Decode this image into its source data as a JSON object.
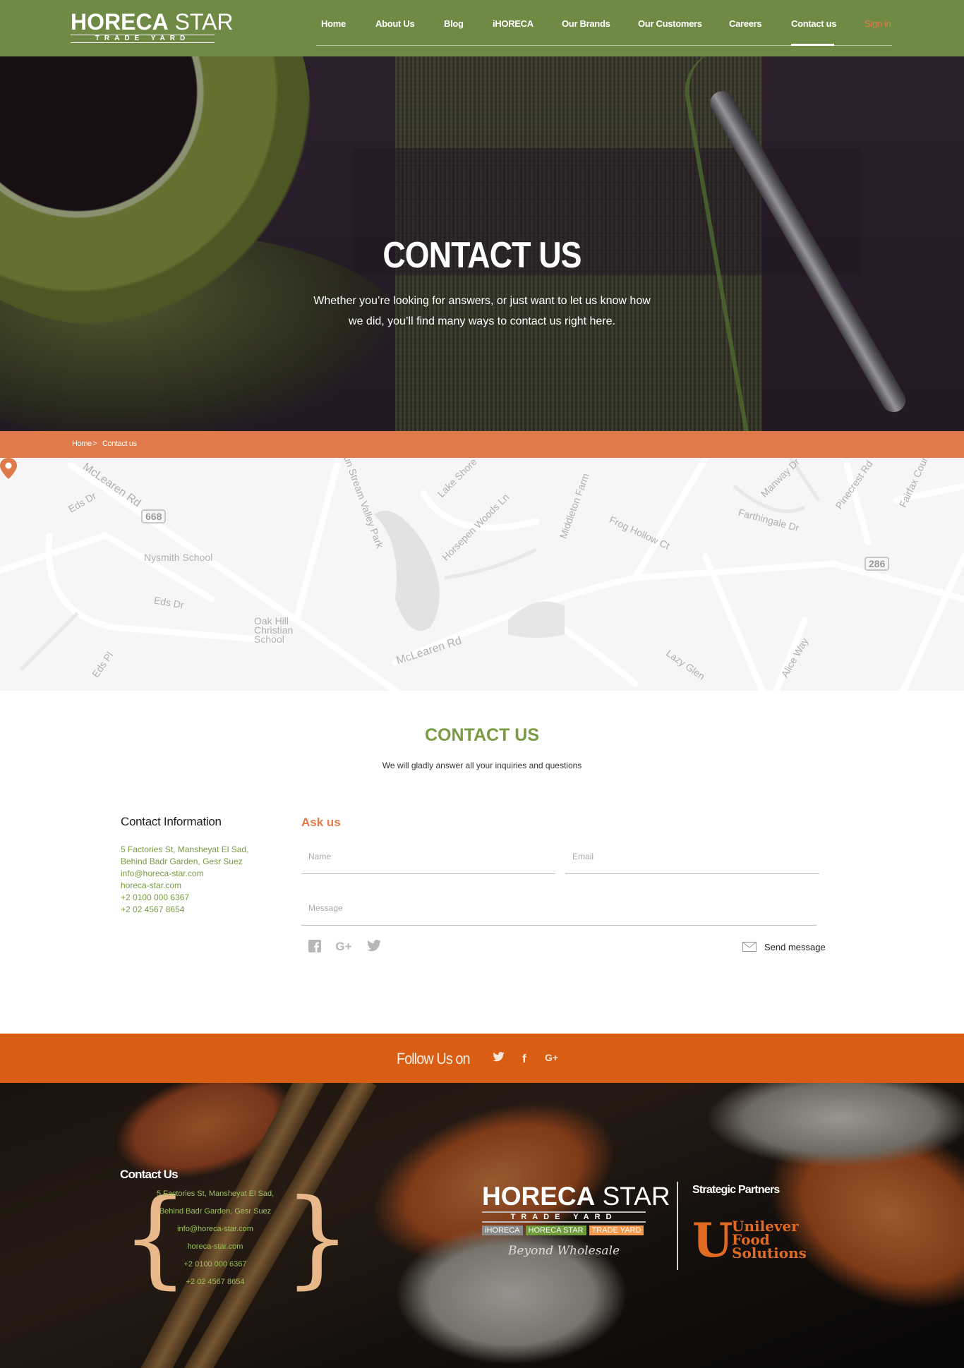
{
  "nav": {
    "logo": {
      "word1": "HORECA",
      "word2": "STAR",
      "sub": "TRADE YARD"
    },
    "items": [
      {
        "label": "Home"
      },
      {
        "label": "About Us"
      },
      {
        "label": "Blog"
      },
      {
        "label": "iHORECA"
      },
      {
        "label": "Our Brands"
      },
      {
        "label": "Our Customers"
      },
      {
        "label": "Careers"
      },
      {
        "label": "Contact us",
        "active": true
      }
    ],
    "signin": "Sign in"
  },
  "hero": {
    "title": "CONTACT US",
    "subtitle": "Whether you’re looking for answers, or just want to let us know how we did, you’ll find many ways to contact us right here."
  },
  "breadcrumb": {
    "home": "Home",
    "sep": ">",
    "current": "Contact us"
  },
  "map": {
    "labels": [
      "McLearen Rd",
      "Eds Dr",
      "668",
      "Nysmith School",
      "Eds Dr",
      "Oak Hill Christian School",
      "McLearen Rd",
      "Lake Shore",
      "Horsepen Woods Ln",
      "Middleton Farm",
      "Frog Hollow Ct",
      "Farthingale Dr",
      "Manway Dr",
      "Pinecrest Rd",
      "Fairfax Coun",
      "286",
      "Sun Stream Valley Park",
      "Lazy Glen",
      "Alice Way",
      "Eds Pl"
    ]
  },
  "contact": {
    "title": "CONTACT US",
    "subtitle": "We will gladly answer all your inquiries and questions",
    "info_heading": "Contact Information",
    "info_lines": [
      "5 Factories St, Mansheyat El Sad,",
      "Behind Badr Garden, Gesr Suez",
      "info@horeca-star.com",
      "horeca-star.com",
      "+2 0100 000 6367",
      "+2 02 4567 8654"
    ],
    "form": {
      "heading": "Ask us",
      "name_placeholder": "Name",
      "email_placeholder": "Email",
      "message_placeholder": "Message",
      "send_label": "Send message"
    },
    "social_icons": [
      "facebook-icon",
      "google-plus-icon",
      "twitter-icon"
    ]
  },
  "follow": {
    "label": "Follow Us on",
    "icons": [
      "twitter-icon",
      "facebook-icon",
      "google-plus-icon"
    ]
  },
  "footer": {
    "contact_heading": "Contact Us",
    "lines": [
      "5 Factories St, Mansheyat El Sad,",
      "Behind Badr Garden, Gesr Suez",
      "info@horeca-star.com",
      "horeca-star.com",
      "+2 0100 000 6367",
      "+2 02 4567 8654"
    ],
    "logo": {
      "word1": "HORECA",
      "word2": "STAR",
      "sub": "TRADE YARD",
      "tag1": "iHORECA",
      "tag2": "HORECA STAR",
      "tag3": "TRADE YARD",
      "tagline": "Beyond Wholesale"
    },
    "partners_heading": "Strategic Partners",
    "partner": {
      "line1": "Unilever",
      "line2": "Food",
      "line3": "Solutions"
    }
  },
  "colors": {
    "nav_green": "#6f8a44",
    "accent_orange": "#e07a4a",
    "follow_orange": "#d95d12",
    "title_green": "#7a9a44"
  }
}
